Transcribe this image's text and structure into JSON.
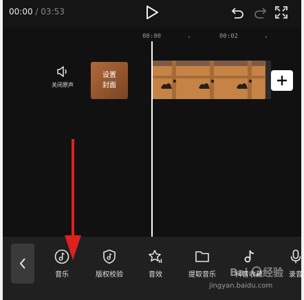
{
  "player": {
    "current_time": "00:00",
    "separator": "/",
    "total_time": "03:53",
    "icons": {
      "play": "play-icon",
      "undo": "undo-icon",
      "redo": "redo-icon",
      "fullscreen": "fullscreen-icon"
    }
  },
  "timeline": {
    "ruler": [
      "00:00",
      "00:02"
    ],
    "mute_label": "关闭原声",
    "cover_lines": [
      "设置",
      "封面"
    ],
    "add_icon": "plus-icon"
  },
  "toolbar": {
    "items": [
      {
        "label": "音乐",
        "icon": "music-note-icon"
      },
      {
        "label": "版权校验",
        "icon": "shield-check-icon"
      },
      {
        "label": "音效",
        "icon": "star-sound-icon"
      },
      {
        "label": "提取音乐",
        "icon": "folder-icon"
      },
      {
        "label": "抖音收藏",
        "icon": "tiktok-icon"
      },
      {
        "label": "录音",
        "icon": "microphone-icon"
      }
    ]
  },
  "watermark": {
    "text": "jingyan.baidu.com"
  },
  "colors": {
    "annotation_arrow": "#e0201e",
    "background": "#161616",
    "clip": "#b9763e"
  }
}
